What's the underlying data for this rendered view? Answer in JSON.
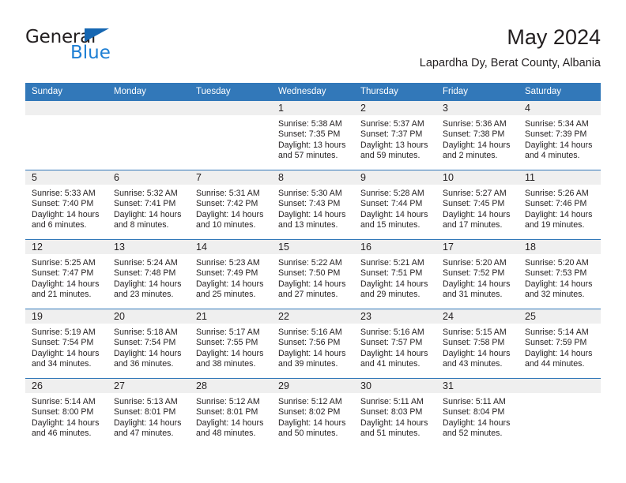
{
  "brand": {
    "word_one": "General",
    "word_two": "Blue",
    "triangle_color": "#1667b2",
    "blue_color": "#1e7fd4"
  },
  "header": {
    "title": "May 2024",
    "subtitle": "Lapardha Dy, Berat County, Albania"
  },
  "theme": {
    "header_blue": "#3278b9",
    "daynum_gray": "#efefef",
    "text": "#231f20"
  },
  "calendar": {
    "weekday_headers": [
      "Sunday",
      "Monday",
      "Tuesday",
      "Wednesday",
      "Thursday",
      "Friday",
      "Saturday"
    ],
    "weeks": [
      [
        {
          "day": "",
          "sunrise": "",
          "sunset": "",
          "daylight_line1": "",
          "daylight_line2": ""
        },
        {
          "day": "",
          "sunrise": "",
          "sunset": "",
          "daylight_line1": "",
          "daylight_line2": ""
        },
        {
          "day": "",
          "sunrise": "",
          "sunset": "",
          "daylight_line1": "",
          "daylight_line2": ""
        },
        {
          "day": "1",
          "sunrise": "Sunrise: 5:38 AM",
          "sunset": "Sunset: 7:35 PM",
          "daylight_line1": "Daylight: 13 hours",
          "daylight_line2": "and 57 minutes."
        },
        {
          "day": "2",
          "sunrise": "Sunrise: 5:37 AM",
          "sunset": "Sunset: 7:37 PM",
          "daylight_line1": "Daylight: 13 hours",
          "daylight_line2": "and 59 minutes."
        },
        {
          "day": "3",
          "sunrise": "Sunrise: 5:36 AM",
          "sunset": "Sunset: 7:38 PM",
          "daylight_line1": "Daylight: 14 hours",
          "daylight_line2": "and 2 minutes."
        },
        {
          "day": "4",
          "sunrise": "Sunrise: 5:34 AM",
          "sunset": "Sunset: 7:39 PM",
          "daylight_line1": "Daylight: 14 hours",
          "daylight_line2": "and 4 minutes."
        }
      ],
      [
        {
          "day": "5",
          "sunrise": "Sunrise: 5:33 AM",
          "sunset": "Sunset: 7:40 PM",
          "daylight_line1": "Daylight: 14 hours",
          "daylight_line2": "and 6 minutes."
        },
        {
          "day": "6",
          "sunrise": "Sunrise: 5:32 AM",
          "sunset": "Sunset: 7:41 PM",
          "daylight_line1": "Daylight: 14 hours",
          "daylight_line2": "and 8 minutes."
        },
        {
          "day": "7",
          "sunrise": "Sunrise: 5:31 AM",
          "sunset": "Sunset: 7:42 PM",
          "daylight_line1": "Daylight: 14 hours",
          "daylight_line2": "and 10 minutes."
        },
        {
          "day": "8",
          "sunrise": "Sunrise: 5:30 AM",
          "sunset": "Sunset: 7:43 PM",
          "daylight_line1": "Daylight: 14 hours",
          "daylight_line2": "and 13 minutes."
        },
        {
          "day": "9",
          "sunrise": "Sunrise: 5:28 AM",
          "sunset": "Sunset: 7:44 PM",
          "daylight_line1": "Daylight: 14 hours",
          "daylight_line2": "and 15 minutes."
        },
        {
          "day": "10",
          "sunrise": "Sunrise: 5:27 AM",
          "sunset": "Sunset: 7:45 PM",
          "daylight_line1": "Daylight: 14 hours",
          "daylight_line2": "and 17 minutes."
        },
        {
          "day": "11",
          "sunrise": "Sunrise: 5:26 AM",
          "sunset": "Sunset: 7:46 PM",
          "daylight_line1": "Daylight: 14 hours",
          "daylight_line2": "and 19 minutes."
        }
      ],
      [
        {
          "day": "12",
          "sunrise": "Sunrise: 5:25 AM",
          "sunset": "Sunset: 7:47 PM",
          "daylight_line1": "Daylight: 14 hours",
          "daylight_line2": "and 21 minutes."
        },
        {
          "day": "13",
          "sunrise": "Sunrise: 5:24 AM",
          "sunset": "Sunset: 7:48 PM",
          "daylight_line1": "Daylight: 14 hours",
          "daylight_line2": "and 23 minutes."
        },
        {
          "day": "14",
          "sunrise": "Sunrise: 5:23 AM",
          "sunset": "Sunset: 7:49 PM",
          "daylight_line1": "Daylight: 14 hours",
          "daylight_line2": "and 25 minutes."
        },
        {
          "day": "15",
          "sunrise": "Sunrise: 5:22 AM",
          "sunset": "Sunset: 7:50 PM",
          "daylight_line1": "Daylight: 14 hours",
          "daylight_line2": "and 27 minutes."
        },
        {
          "day": "16",
          "sunrise": "Sunrise: 5:21 AM",
          "sunset": "Sunset: 7:51 PM",
          "daylight_line1": "Daylight: 14 hours",
          "daylight_line2": "and 29 minutes."
        },
        {
          "day": "17",
          "sunrise": "Sunrise: 5:20 AM",
          "sunset": "Sunset: 7:52 PM",
          "daylight_line1": "Daylight: 14 hours",
          "daylight_line2": "and 31 minutes."
        },
        {
          "day": "18",
          "sunrise": "Sunrise: 5:20 AM",
          "sunset": "Sunset: 7:53 PM",
          "daylight_line1": "Daylight: 14 hours",
          "daylight_line2": "and 32 minutes."
        }
      ],
      [
        {
          "day": "19",
          "sunrise": "Sunrise: 5:19 AM",
          "sunset": "Sunset: 7:54 PM",
          "daylight_line1": "Daylight: 14 hours",
          "daylight_line2": "and 34 minutes."
        },
        {
          "day": "20",
          "sunrise": "Sunrise: 5:18 AM",
          "sunset": "Sunset: 7:54 PM",
          "daylight_line1": "Daylight: 14 hours",
          "daylight_line2": "and 36 minutes."
        },
        {
          "day": "21",
          "sunrise": "Sunrise: 5:17 AM",
          "sunset": "Sunset: 7:55 PM",
          "daylight_line1": "Daylight: 14 hours",
          "daylight_line2": "and 38 minutes."
        },
        {
          "day": "22",
          "sunrise": "Sunrise: 5:16 AM",
          "sunset": "Sunset: 7:56 PM",
          "daylight_line1": "Daylight: 14 hours",
          "daylight_line2": "and 39 minutes."
        },
        {
          "day": "23",
          "sunrise": "Sunrise: 5:16 AM",
          "sunset": "Sunset: 7:57 PM",
          "daylight_line1": "Daylight: 14 hours",
          "daylight_line2": "and 41 minutes."
        },
        {
          "day": "24",
          "sunrise": "Sunrise: 5:15 AM",
          "sunset": "Sunset: 7:58 PM",
          "daylight_line1": "Daylight: 14 hours",
          "daylight_line2": "and 43 minutes."
        },
        {
          "day": "25",
          "sunrise": "Sunrise: 5:14 AM",
          "sunset": "Sunset: 7:59 PM",
          "daylight_line1": "Daylight: 14 hours",
          "daylight_line2": "and 44 minutes."
        }
      ],
      [
        {
          "day": "26",
          "sunrise": "Sunrise: 5:14 AM",
          "sunset": "Sunset: 8:00 PM",
          "daylight_line1": "Daylight: 14 hours",
          "daylight_line2": "and 46 minutes."
        },
        {
          "day": "27",
          "sunrise": "Sunrise: 5:13 AM",
          "sunset": "Sunset: 8:01 PM",
          "daylight_line1": "Daylight: 14 hours",
          "daylight_line2": "and 47 minutes."
        },
        {
          "day": "28",
          "sunrise": "Sunrise: 5:12 AM",
          "sunset": "Sunset: 8:01 PM",
          "daylight_line1": "Daylight: 14 hours",
          "daylight_line2": "and 48 minutes."
        },
        {
          "day": "29",
          "sunrise": "Sunrise: 5:12 AM",
          "sunset": "Sunset: 8:02 PM",
          "daylight_line1": "Daylight: 14 hours",
          "daylight_line2": "and 50 minutes."
        },
        {
          "day": "30",
          "sunrise": "Sunrise: 5:11 AM",
          "sunset": "Sunset: 8:03 PM",
          "daylight_line1": "Daylight: 14 hours",
          "daylight_line2": "and 51 minutes."
        },
        {
          "day": "31",
          "sunrise": "Sunrise: 5:11 AM",
          "sunset": "Sunset: 8:04 PM",
          "daylight_line1": "Daylight: 14 hours",
          "daylight_line2": "and 52 minutes."
        },
        {
          "day": "",
          "sunrise": "",
          "sunset": "",
          "daylight_line1": "",
          "daylight_line2": ""
        }
      ]
    ]
  }
}
